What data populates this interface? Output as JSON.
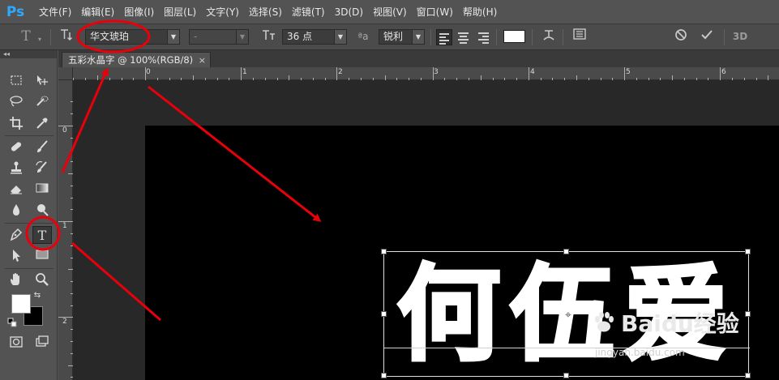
{
  "app": {
    "logo": "Ps"
  },
  "menu": {
    "items": [
      "文件(F)",
      "编辑(E)",
      "图像(I)",
      "图层(L)",
      "文字(Y)",
      "选择(S)",
      "滤镜(T)",
      "3D(D)",
      "视图(V)",
      "窗口(W)",
      "帮助(H)"
    ]
  },
  "options": {
    "tool_icon": "T",
    "font_family": "华文琥珀",
    "font_style": "-",
    "font_size": "36 点",
    "aa_label": "ªa",
    "antialias": "锐利",
    "text_color": "#ffffff",
    "mode_3d": "3D"
  },
  "document": {
    "tab_title": "五彩水晶字 @ 100%(RGB/8)",
    "tab_close": "×",
    "ruler_h": [
      "0",
      "1",
      "2",
      "3",
      "4",
      "5",
      "6"
    ],
    "ruler_v": [
      "0",
      "1",
      "2"
    ],
    "canvas_text": "何伍爱"
  },
  "tools": {
    "fg_color": "#ffffff",
    "bg_color": "#000000"
  },
  "annotation_color": "#e8000b",
  "watermark": {
    "brand": "Baidu经验",
    "url": "jingyan.baidu.com"
  }
}
